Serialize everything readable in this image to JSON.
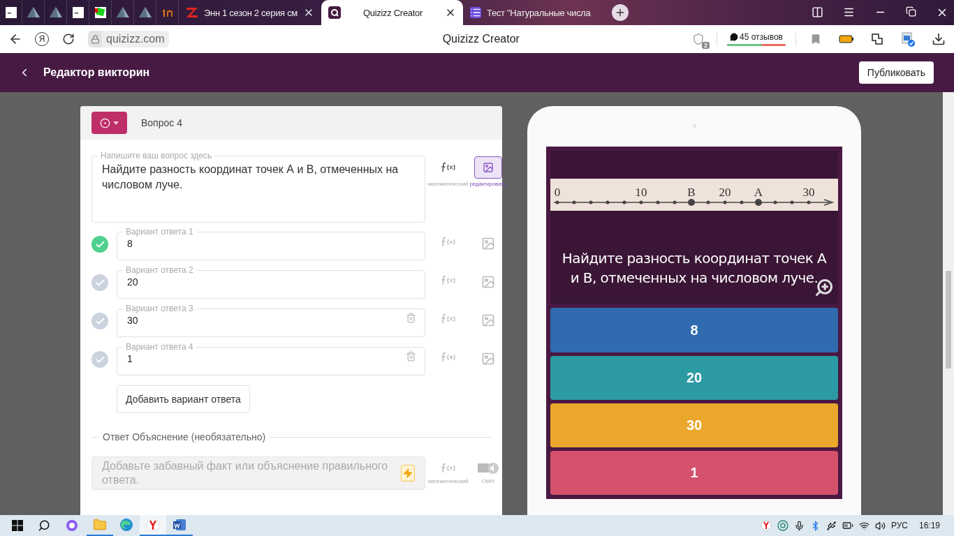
{
  "browser": {
    "tabs": [
      {
        "kind": "blank",
        "selected": false
      },
      {
        "kind": "pyramid",
        "selected": false
      },
      {
        "kind": "pyramid",
        "selected": false
      },
      {
        "kind": "blank",
        "selected": false
      },
      {
        "kind": "greenbox",
        "selected": false
      },
      {
        "kind": "pyramid",
        "selected": false
      },
      {
        "kind": "pyramid",
        "selected": false
      },
      {
        "kind": "orange",
        "selected": false
      },
      {
        "kind": "zlogo",
        "title": "Энн 1 сезон 2 серия см",
        "selected": false
      },
      {
        "kind": "quizizz",
        "title": "Quizizz Creator",
        "selected": true
      },
      {
        "kind": "list",
        "title": "Тест \"Натуральные числа",
        "selected": false
      }
    ],
    "home_label": "Я",
    "url": "quizizz.com",
    "page_title": "Quizizz Creator",
    "shield_badge": "2",
    "reviews": {
      "text": "45 отзывов",
      "level": 0.6
    }
  },
  "app_header": {
    "title": "Редактор викторин",
    "publish": "Публиковать"
  },
  "editor": {
    "question_number": "Вопрос 4",
    "question": {
      "label": "Напишите ваш вопрос здесь",
      "text": "Найдите разность координат точек А и В, отмеченных на числовом луче.",
      "math_label": "математический",
      "image_label": "редактировать",
      "image_attached": true
    },
    "answers": [
      {
        "label": "Вариант ответа 1",
        "value": "8",
        "correct": true,
        "deletable": false
      },
      {
        "label": "Вариант ответа 2",
        "value": "20",
        "correct": false,
        "deletable": false
      },
      {
        "label": "Вариант ответа 3",
        "value": "30",
        "correct": false,
        "deletable": true
      },
      {
        "label": "Вариант ответа 4",
        "value": "1",
        "correct": false,
        "deletable": true
      }
    ],
    "add_answer": "Добавить вариант ответа",
    "explanation": {
      "heading": "Ответ Объяснение (необязательно)",
      "placeholder": "Добавьте забавный факт или объяснение правильного ответа.",
      "math_label": "математический",
      "media_label": "СМИ"
    }
  },
  "preview": {
    "number_line": [
      {
        "label": "0",
        "point": false
      },
      {
        "point": false
      },
      {
        "point": false
      },
      {
        "point": false
      },
      {
        "point": false
      },
      {
        "label": "10",
        "point": false
      },
      {
        "point": false
      },
      {
        "point": false
      },
      {
        "label": "B",
        "point": true
      },
      {
        "point": false
      },
      {
        "label": "20",
        "point": false
      },
      {
        "point": false
      },
      {
        "label": "A",
        "point": true
      },
      {
        "point": false
      },
      {
        "point": false
      },
      {
        "label": "30",
        "point": false
      }
    ],
    "question": "Найдите разность координат точек А и В, отмеченных на числовом луче.",
    "answers": [
      {
        "text": "8",
        "color": "#2f6bae"
      },
      {
        "text": "20",
        "color": "#2c9aa3"
      },
      {
        "text": "30",
        "color": "#eba72b"
      },
      {
        "text": "1",
        "color": "#d4526c"
      }
    ]
  },
  "taskbar": {
    "apps": [
      {
        "kind": "explorer",
        "running": true,
        "selected": false
      },
      {
        "kind": "edge",
        "running": false,
        "selected": false
      },
      {
        "kind": "yandex",
        "running": true,
        "selected": true
      },
      {
        "kind": "word",
        "running": true,
        "selected": false
      }
    ],
    "language": "РУС",
    "time": "16:19"
  }
}
